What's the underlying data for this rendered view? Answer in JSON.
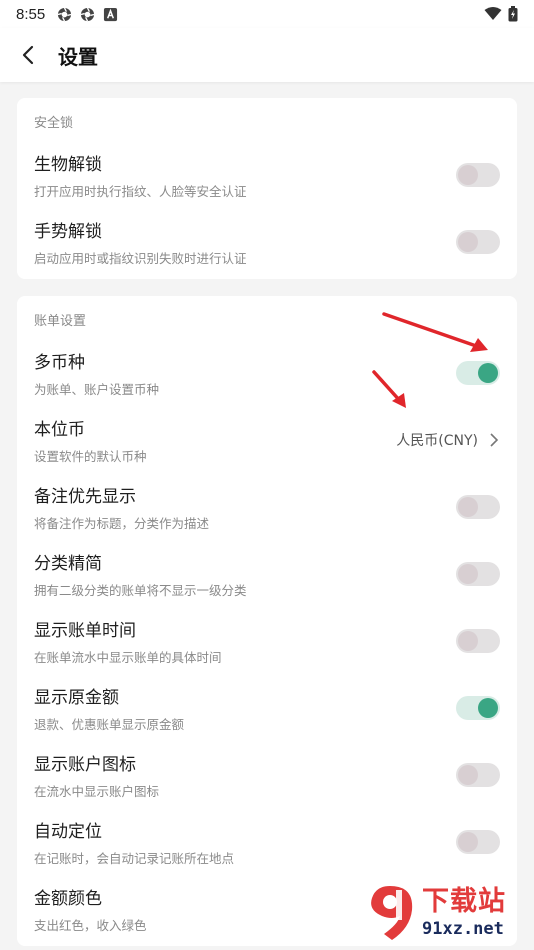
{
  "status_bar": {
    "time": "8:55",
    "icons": [
      "aperture-icon",
      "aperture-icon",
      "a-box-icon"
    ],
    "right_icons": [
      "wifi-icon",
      "battery-icon"
    ]
  },
  "header": {
    "title": "设置",
    "back_icon": "back-arrow-icon"
  },
  "security": {
    "label": "安全锁",
    "items": [
      {
        "title": "生物解锁",
        "desc": "打开应用时执行指纹、人脸等安全认证",
        "on": false
      },
      {
        "title": "手势解锁",
        "desc": "启动应用时或指纹识别失败时进行认证",
        "on": false
      }
    ]
  },
  "bill": {
    "label": "账单设置",
    "items": [
      {
        "title": "多币种",
        "desc": "为账单、账户设置币种",
        "type": "toggle",
        "on": true
      },
      {
        "title": "本位币",
        "desc": "设置软件的默认币种",
        "type": "select",
        "value": "人民币(CNY)"
      },
      {
        "title": "备注优先显示",
        "desc": "将备注作为标题，分类作为描述",
        "type": "toggle",
        "on": false
      },
      {
        "title": "分类精简",
        "desc": "拥有二级分类的账单将不显示一级分类",
        "type": "toggle",
        "on": false
      },
      {
        "title": "显示账单时间",
        "desc": "在账单流水中显示账单的具体时间",
        "type": "toggle",
        "on": false
      },
      {
        "title": "显示原金额",
        "desc": "退款、优惠账单显示原金额",
        "type": "toggle",
        "on": true
      },
      {
        "title": "显示账户图标",
        "desc": "在流水中显示账户图标",
        "type": "toggle",
        "on": false
      },
      {
        "title": "自动定位",
        "desc": "在记账时，会自动记录记账所在地点",
        "type": "toggle",
        "on": false
      },
      {
        "title": "金额颜色",
        "desc": "支出红色，收入绿色",
        "type": "none"
      }
    ]
  },
  "watermark": {
    "big": "下载站",
    "small": "91xz.net"
  },
  "colors": {
    "toggle_on": "#3aa684",
    "toggle_off": "#d8cfd2",
    "arrow": "#e0262b",
    "watermark_red": "#e23b3b"
  }
}
